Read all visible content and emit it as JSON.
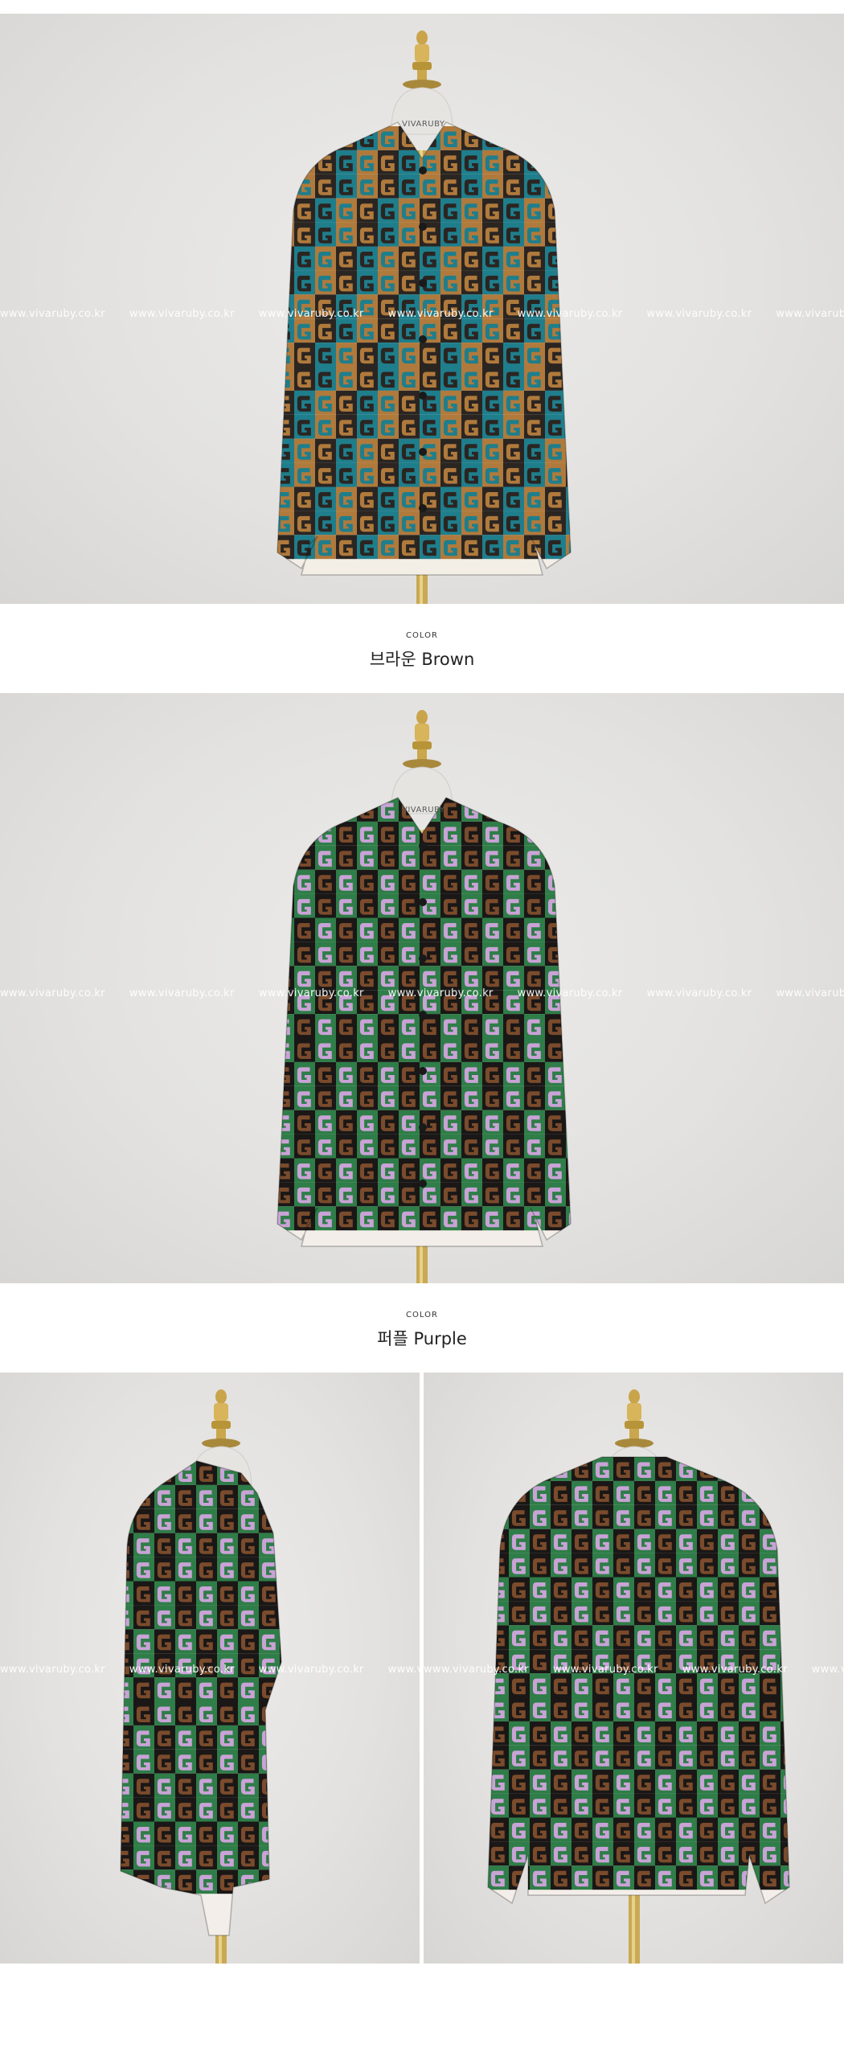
{
  "watermark_text": "www.vivaruby.co.kr",
  "form_brand": "VIVARUBY",
  "sections": [
    {
      "label": "COLOR",
      "name": "브라운 Brown"
    },
    {
      "label": "COLOR",
      "name": "퍼플 Purple"
    }
  ],
  "colors": {
    "brown_palette": [
      "#2b2522",
      "#b07a3c",
      "#1f7e8c",
      "#f3efe6"
    ],
    "purple_palette": [
      "#1a1716",
      "#7a4b2c",
      "#2f7d48",
      "#c9a3d6",
      "#f3eee9"
    ],
    "background": "#e4e3e1"
  },
  "images": [
    {
      "name": "brown-blouse-front-photo",
      "icon": "blouse-on-mannequin"
    },
    {
      "name": "purple-blouse-front-photo",
      "icon": "blouse-on-mannequin"
    },
    {
      "name": "purple-blouse-side-photo",
      "icon": "blouse-on-mannequin"
    },
    {
      "name": "purple-blouse-back-photo",
      "icon": "blouse-on-mannequin"
    }
  ]
}
